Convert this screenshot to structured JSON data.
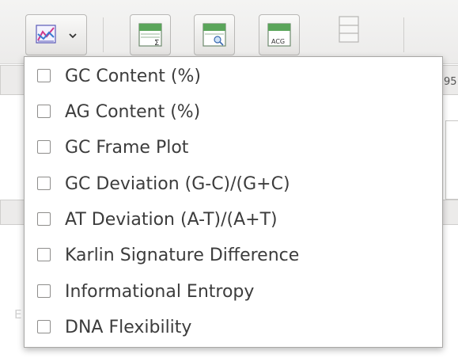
{
  "toolbar": {
    "chart_button_icon": "line-chart-icon",
    "dropdown_icon": "chevron-down-icon",
    "acg_button_label": "ACG",
    "sum_symbol": "Σ"
  },
  "background": {
    "ruler_label": "95"
  },
  "menu": {
    "items": [
      {
        "label": "GC Content (%)",
        "checked": false
      },
      {
        "label": "AG Content (%)",
        "checked": false
      },
      {
        "label": "GC Frame Plot",
        "checked": false
      },
      {
        "label": "GC Deviation (G-C)/(G+C)",
        "checked": false
      },
      {
        "label": "AT Deviation (A-T)/(A+T)",
        "checked": false
      },
      {
        "label": "Karlin Signature Difference",
        "checked": false
      },
      {
        "label": "Informational Entropy",
        "checked": false
      },
      {
        "label": "DNA Flexibility",
        "checked": false
      }
    ]
  }
}
